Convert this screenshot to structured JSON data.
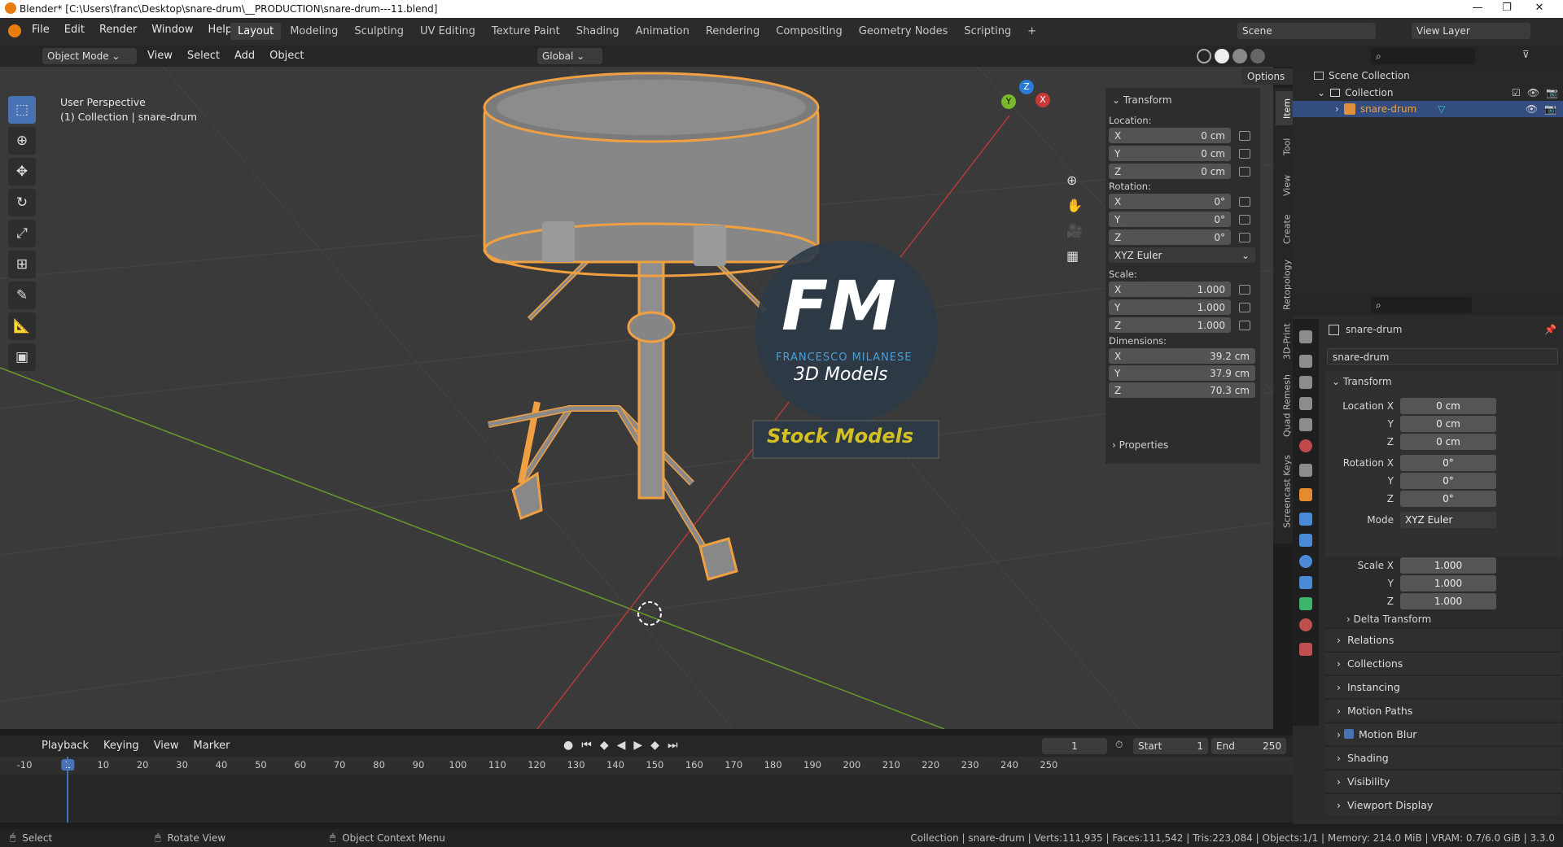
{
  "window": {
    "title": "Blender* [C:\\Users\\franc\\Desktop\\snare-drum\\__PRODUCTION\\snare-drum---11.blend]",
    "controls": [
      "—",
      "❐",
      "✕"
    ]
  },
  "menu": [
    "File",
    "Edit",
    "Render",
    "Window",
    "Help"
  ],
  "workspaces": [
    "Layout",
    "Modeling",
    "Sculpting",
    "UV Editing",
    "Texture Paint",
    "Shading",
    "Animation",
    "Rendering",
    "Compositing",
    "Geometry Nodes",
    "Scripting"
  ],
  "workspace_add": "+",
  "scene": {
    "name": "Scene",
    "view_layer": "View Layer"
  },
  "viewport_header": {
    "mode": "Object Mode",
    "menus": [
      "View",
      "Select",
      "Add",
      "Object"
    ],
    "orientation": "Global",
    "options": "Options"
  },
  "viewport": {
    "perspective": "User Perspective",
    "collection_info": "(1) Collection | snare-drum",
    "gizmo": {
      "x": "X",
      "y": "Y",
      "z": "Z"
    },
    "watermark": {
      "letters": "FM",
      "line1": "FRANCESCO MILANESE",
      "line2": "3D Models",
      "banner": "Stock Models"
    }
  },
  "npanel": {
    "transform_header": "Transform",
    "location_label": "Location:",
    "location": [
      {
        "axis": "X",
        "value": "0 cm"
      },
      {
        "axis": "Y",
        "value": "0 cm"
      },
      {
        "axis": "Z",
        "value": "0 cm"
      }
    ],
    "rotation_label": "Rotation:",
    "rotation": [
      {
        "axis": "X",
        "value": "0°"
      },
      {
        "axis": "Y",
        "value": "0°"
      },
      {
        "axis": "Z",
        "value": "0°"
      }
    ],
    "rotation_mode": "XYZ Euler",
    "scale_label": "Scale:",
    "scale": [
      {
        "axis": "X",
        "value": "1.000"
      },
      {
        "axis": "Y",
        "value": "1.000"
      },
      {
        "axis": "Z",
        "value": "1.000"
      }
    ],
    "dimensions_label": "Dimensions:",
    "dimensions": [
      {
        "axis": "X",
        "value": "39.2 cm"
      },
      {
        "axis": "Y",
        "value": "37.9 cm"
      },
      {
        "axis": "Z",
        "value": "70.3 cm"
      }
    ],
    "properties_header": "Properties"
  },
  "sidebar_tabs": [
    "Item",
    "Tool",
    "View",
    "Create",
    "Retopology",
    "3D-Print",
    "Quad Remesh",
    "Screencast Keys"
  ],
  "outliner": {
    "scene_collection": "Scene Collection",
    "collection": "Collection",
    "object": "snare-drum"
  },
  "properties": {
    "object_name": "snare-drum",
    "object_field": "snare-drum",
    "transform_header": "Transform",
    "location": [
      {
        "label": "Location X",
        "value": "0 cm"
      },
      {
        "label": "Y",
        "value": "0 cm"
      },
      {
        "label": "Z",
        "value": "0 cm"
      }
    ],
    "rotation": [
      {
        "label": "Rotation X",
        "value": "0°"
      },
      {
        "label": "Y",
        "value": "0°"
      },
      {
        "label": "Z",
        "value": "0°"
      }
    ],
    "mode_label": "Mode",
    "mode_value": "XYZ Euler",
    "scale": [
      {
        "label": "Scale X",
        "value": "1.000"
      },
      {
        "label": "Y",
        "value": "1.000"
      },
      {
        "label": "Z",
        "value": "1.000"
      }
    ],
    "delta_transform": "Delta Transform",
    "sections": [
      "Relations",
      "Collections",
      "Instancing",
      "Motion Paths",
      "Motion Blur",
      "Shading",
      "Visibility",
      "Viewport Display"
    ]
  },
  "timeline": {
    "menus": [
      "Playback",
      "Keying",
      "View",
      "Marker"
    ],
    "current_frame": "1",
    "start_label": "Start",
    "start": "1",
    "end_label": "End",
    "end": "250",
    "ruler": [
      "-10",
      "1",
      "10",
      "20",
      "30",
      "40",
      "50",
      "60",
      "70",
      "80",
      "90",
      "100",
      "110",
      "120",
      "130",
      "140",
      "150",
      "160",
      "170",
      "180",
      "190",
      "200",
      "210",
      "220",
      "230",
      "240",
      "250"
    ]
  },
  "statusbar": {
    "hints": [
      "Select",
      "Rotate View",
      "Object Context Menu"
    ],
    "stats": "Collection | snare-drum | Verts:111,935 | Faces:111,542 | Tris:223,084 | Objects:1/1 | Memory: 214.0 MiB | VRAM: 0.7/6.0 GiB | 3.3.0"
  },
  "colors": {
    "accent": "#4772b3",
    "selection": "#f0a040",
    "x_axis": "#c83a3a",
    "y_axis": "#7ab72a",
    "z_axis": "#2a7bd6"
  }
}
